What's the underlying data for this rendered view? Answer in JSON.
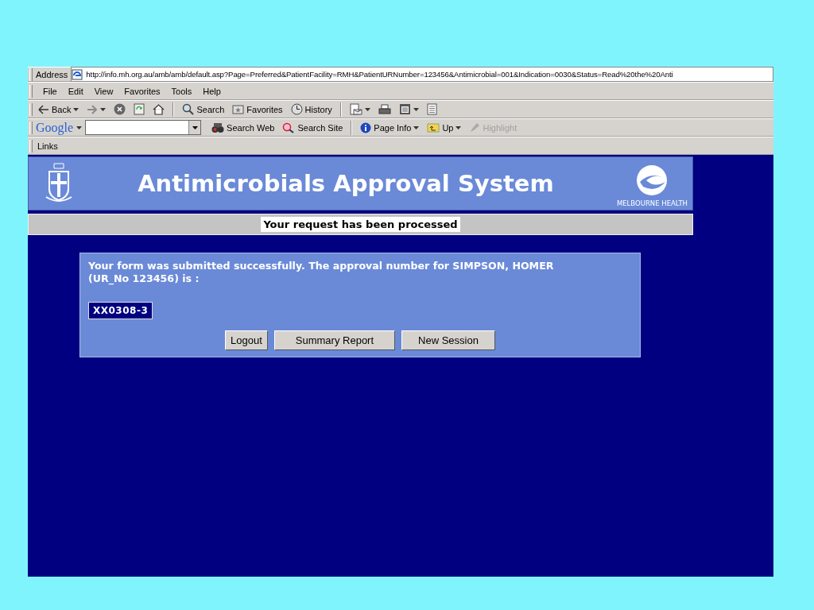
{
  "address_bar": {
    "label": "Address",
    "url": "http://info.mh.org.au/amb/amb/default.asp?Page=Preferred&PatientFacility=RMH&PatientURNumber=123456&Antimicrobial=001&Indication=0030&Status=Read%20the%20Anti"
  },
  "menu": [
    "File",
    "Edit",
    "View",
    "Favorites",
    "Tools",
    "Help"
  ],
  "toolbar": [
    {
      "kind": "back",
      "label": "Back",
      "dropdown": true
    },
    {
      "kind": "forward",
      "dropdown": true
    },
    {
      "kind": "stop"
    },
    {
      "kind": "refresh"
    },
    {
      "kind": "home"
    },
    {
      "kind": "search",
      "label": "Search"
    },
    {
      "kind": "favorites",
      "label": "Favorites"
    },
    {
      "kind": "history",
      "label": "History"
    },
    {
      "kind": "mail",
      "dropdown": true
    },
    {
      "kind": "print"
    },
    {
      "kind": "edit",
      "dropdown": true
    },
    {
      "kind": "discuss"
    }
  ],
  "google_bar": {
    "logo": "Google",
    "items": [
      {
        "kind": "searchweb",
        "label": "Search Web",
        "disabled": false,
        "dropdown": false
      },
      {
        "kind": "searchsite",
        "label": "Search Site",
        "disabled": false,
        "dropdown": false
      },
      {
        "kind": "pageinfo",
        "label": "Page Info",
        "disabled": false,
        "dropdown": true
      },
      {
        "kind": "up",
        "label": "Up",
        "disabled": false,
        "dropdown": true
      },
      {
        "kind": "highlight",
        "label": "Highlight",
        "disabled": true,
        "dropdown": false
      }
    ]
  },
  "links_bar": {
    "label": "Links"
  },
  "header": {
    "title": "Antimicrobials Approval System",
    "brand": "MELBOURNE HEALTH"
  },
  "status": "Your request has been processed",
  "result": {
    "message": "Your form was submitted successfully. The approval number for SIMPSON, HOMER (UR_No 123456) is :",
    "approval_number": "XX0308-3",
    "buttons": [
      "Logout",
      "Summary Report",
      "New Session"
    ]
  }
}
